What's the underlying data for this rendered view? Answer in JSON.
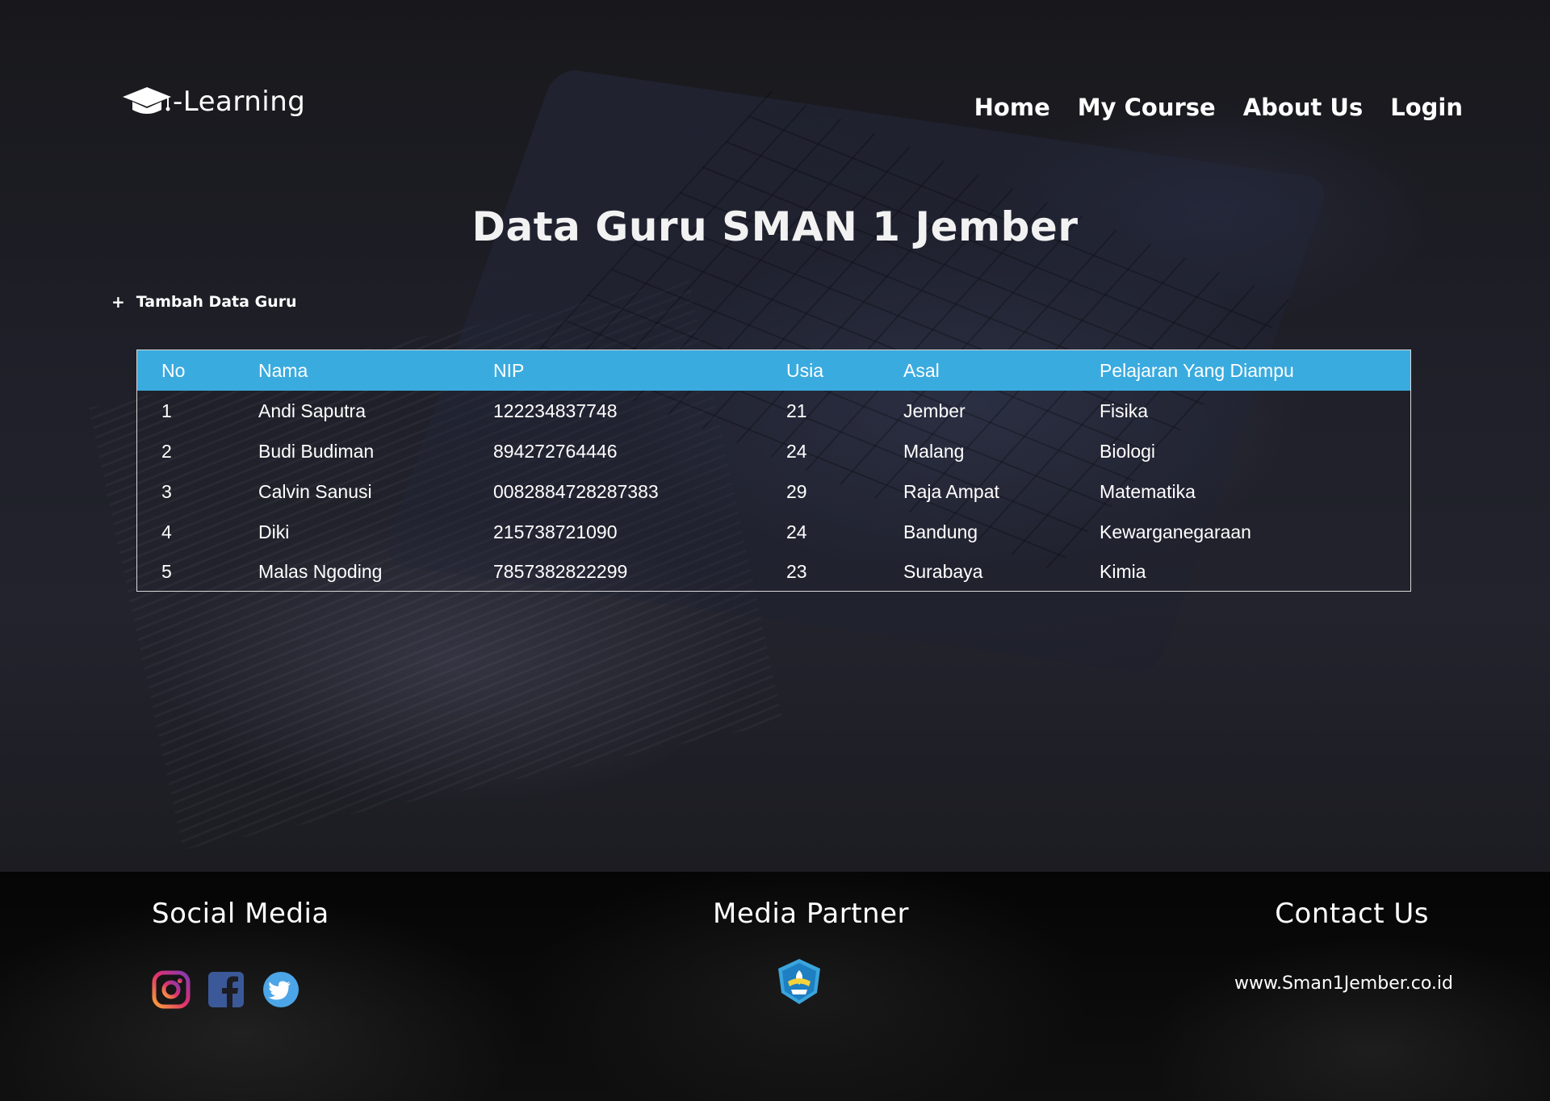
{
  "brand": {
    "logo_icon": "graduation-cap-icon",
    "name": "-Learning"
  },
  "nav": {
    "items": [
      "Home",
      "My Course",
      "About Us",
      "Login"
    ]
  },
  "page_title": "Data Guru SMAN 1 Jember",
  "add_button": {
    "icon": "+",
    "label": "Tambah Data Guru"
  },
  "table": {
    "header_color": "#3aabdf",
    "columns": [
      "No",
      "Nama",
      "NIP",
      "Usia",
      "Asal",
      "Pelajaran Yang Diampu"
    ],
    "rows": [
      [
        "1",
        "Andi Saputra",
        "122234837748",
        "21",
        "Jember",
        "Fisika"
      ],
      [
        "2",
        "Budi Budiman",
        "894272764446",
        "24",
        "Malang",
        "Biologi"
      ],
      [
        "3",
        "Calvin Sanusi",
        "0082884728287383",
        "29",
        "Raja Ampat",
        "Matematika"
      ],
      [
        "4",
        "Diki",
        "215738721090",
        "24",
        "Bandung",
        "Kewarganegaraan"
      ],
      [
        "5",
        "Malas Ngoding",
        "7857382822299",
        "23",
        "Surabaya",
        "Kimia"
      ]
    ]
  },
  "footer": {
    "social_media": {
      "heading": "Social Media",
      "icons": [
        "instagram-icon",
        "facebook-icon",
        "twitter-icon"
      ]
    },
    "media_partner": {
      "heading": "Media Partner",
      "logo": "tut-wuri-handayani-logo"
    },
    "contact": {
      "heading": "Contact Us",
      "url": "www.Sman1Jember.co.id"
    }
  }
}
